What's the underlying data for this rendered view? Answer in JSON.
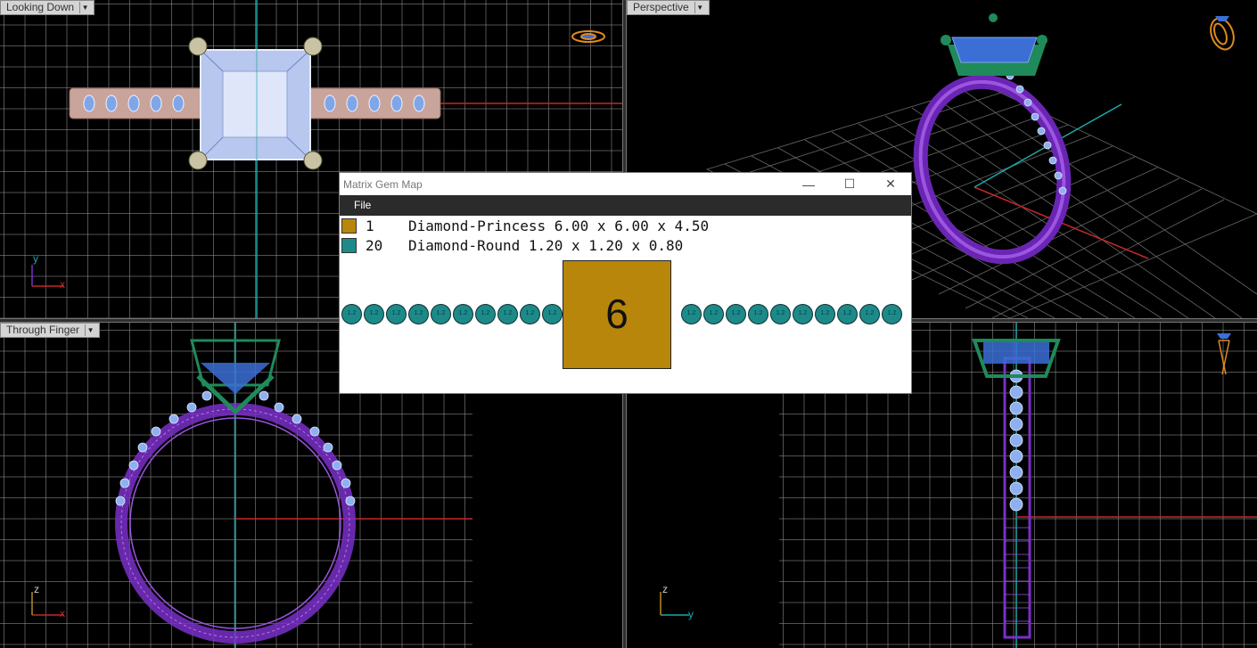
{
  "viewports": {
    "top_left": {
      "label": "Looking Down",
      "axis_a": "y",
      "axis_b": "x"
    },
    "top_right": {
      "label": "Perspective"
    },
    "bottom_left": {
      "label": "Through Finger",
      "axis_a": "z",
      "axis_b": "x"
    },
    "bottom_right": {
      "axis_a": "z",
      "axis_b": "y"
    }
  },
  "dialog": {
    "title": "Matrix Gem Map",
    "menu": {
      "file": "File"
    },
    "gems": [
      {
        "count": "1",
        "description": "Diamond-Princess 6.00 x 6.00 x 4.50",
        "color": "#b8860b"
      },
      {
        "count": "20",
        "description": "Diamond-Round 1.20 x 1.20 x 0.80",
        "color": "#1d8a8a"
      }
    ],
    "map": {
      "center_label": "6",
      "round_label": "1.2",
      "left_count": 10,
      "right_count": 10
    }
  },
  "colors": {
    "accent_metal": "#7a2fc9",
    "prong": "#1f8a5a",
    "center_stone": "#3b6fd6",
    "axis_x": "#c62828",
    "axis_y": "#1fa8a8"
  }
}
